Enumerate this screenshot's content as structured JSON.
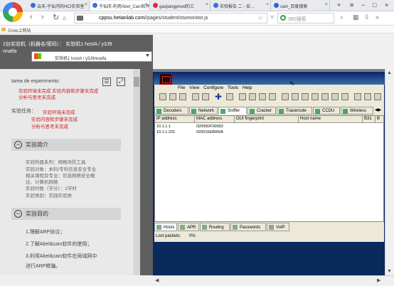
{
  "browser": {
    "tabs": [
      {
        "label": "云天-于仙河的HCI实验室"
      },
      {
        "label": "于仙庆-利用Abel_Cain软件"
      },
      {
        "label": "gaojiangpnwd的三"
      },
      {
        "label": "实验报告 二 - 安..."
      },
      {
        "label": "cain_百度搜索"
      }
    ],
    "new_tab": "+",
    "controls": {
      "menu": "≡",
      "min": "−",
      "max": "□",
      "close": "×"
    },
    "url_domain": "cppsu.hetianlab.com",
    "url_path": "//pages/student/stumonitor.js",
    "search_placeholder": "360搜索",
    "bookmark_label": "Grow上网站"
  },
  "page": {
    "header_line1": "2台实验机（机器名/密码）： 实验机1 hostA / y3J9",
    "header_line2": "nnatfa",
    "machine_select": "实验机1 hostA / y3J9nnatfa",
    "tarea_label": "tarea de experimento:",
    "status_items": [
      "实验环境未完成 实验内容和步骤未完成",
      "分析与思考未完成"
    ],
    "task_label": "实验任务：",
    "task_items": [
      "实验环境未完成",
      "实验内容和步骤未完成",
      "分析与思考未完成"
    ],
    "section_intro": "实验简介",
    "intro_bullets": [
      "实验所属系列：网络攻防工具",
      "实验对象：本科/专科信息安全专业",
      "相关课程及专业：信息网络安全概",
      "论、计算机网络",
      "实验时数（学分）：2学时",
      "实验类别：实践实验类"
    ],
    "section_goal": "实验目的",
    "goals": [
      "1.理解ARP协议；",
      "2.了解Abel&cain软件的使用；",
      "3.利用Abel&cain软件在局域网中",
      "进行ARP欺骗。"
    ]
  },
  "cain": {
    "menu": [
      "File",
      "View",
      "Configure",
      "Tools",
      "Help"
    ],
    "tabs": [
      "Decoders",
      "Network",
      "Sniffer",
      "Cracker",
      "Traceroute",
      "CCDU",
      "Wireless"
    ],
    "columns": [
      "IP address",
      "MAC address",
      "OUI fingerprint",
      "Host name",
      "B31",
      "B"
    ],
    "rows": [
      {
        "ip": "10.1.1.1",
        "mac": "02005DF00002"
      },
      {
        "ip": "10.1.1.231",
        "mac": "020015E8000A"
      }
    ],
    "bottom_tabs": [
      "Hosts",
      "APR",
      "Routing",
      "Passwords",
      "VoIP"
    ],
    "status_label": "Lost packets:",
    "status_value": "0%"
  }
}
